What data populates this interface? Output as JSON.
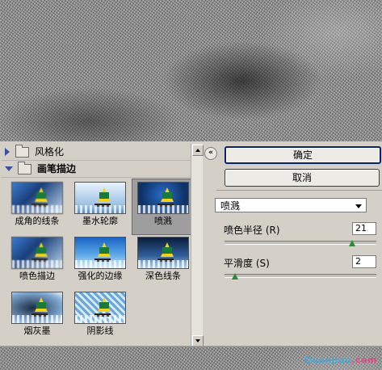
{
  "watermark": {
    "part1": "Quanjiao",
    "part2": ".com"
  },
  "filter_tree": {
    "collapsed_folder": {
      "label": "风格化"
    },
    "open_folder": {
      "label": "画笔描边",
      "thumbnails": [
        {
          "label": "成角的线条",
          "selected": false,
          "style": "blur"
        },
        {
          "label": "墨水轮廓",
          "selected": false,
          "style": "ink"
        },
        {
          "label": "喷溅",
          "selected": true,
          "style": "spray"
        },
        {
          "label": "喷色描边",
          "selected": false,
          "style": "blur"
        },
        {
          "label": "强化的边缘",
          "selected": false,
          "style": "normal"
        },
        {
          "label": "深色线条",
          "selected": false,
          "style": "dark"
        },
        {
          "label": "烟灰墨",
          "selected": false,
          "style": "smoke"
        },
        {
          "label": "阴影线",
          "selected": false,
          "style": "cross"
        }
      ]
    }
  },
  "controls": {
    "collapse_glyph": "«",
    "ok_label": "确定",
    "cancel_label": "取消",
    "filter_select": "喷溅",
    "params": [
      {
        "label": "喷色半径 (R)",
        "value": "21",
        "level": 0.84
      },
      {
        "label": "平滑度 (S)",
        "value": "2",
        "level": 0.07
      }
    ]
  },
  "colors": {
    "accent_border": "#0a246a",
    "slider_handle": "#2e8b3b",
    "dialog_bg": "#d4d0c8"
  }
}
